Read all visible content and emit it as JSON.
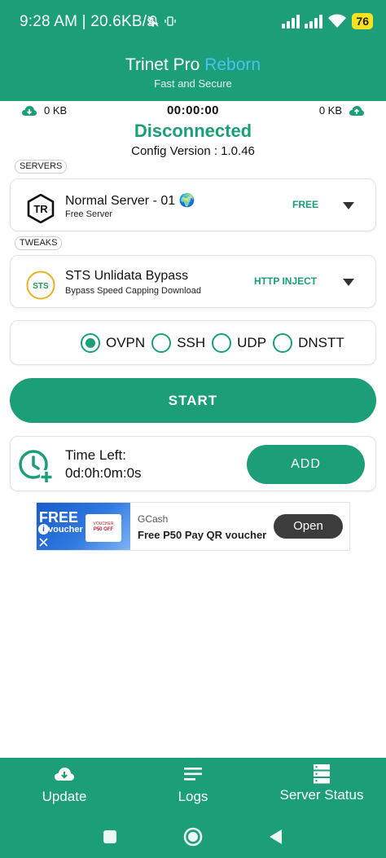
{
  "colors": {
    "accent": "#1c9e78",
    "title_highlight": "#48c3f5",
    "battery": "#f7e21f",
    "ad_button": "#3c3c3c"
  },
  "status_bar": {
    "time_speed": "9:28 AM | 20.6KB/s",
    "battery": "76",
    "icons": [
      "mute-icon",
      "vibrate-icon",
      "signal-icon",
      "signal-icon",
      "wifi-icon",
      "battery-icon"
    ]
  },
  "header": {
    "title_main": "Trinet Pro",
    "title_highlight": "Reborn",
    "subtitle": "Fast and Secure"
  },
  "traffic": {
    "download": "0 KB",
    "timer": "00:00:00",
    "upload": "0 KB"
  },
  "connection": {
    "status": "Disconnected",
    "config_version": "Config Version : 1.0.46"
  },
  "servers": {
    "section_label": "SERVERS",
    "name": "Normal Server - 01 🌍",
    "subtitle": "Free Server",
    "tag": "FREE",
    "logo_text": "TR"
  },
  "tweaks": {
    "section_label": "TWEAKS",
    "name": "STS Unlidata Bypass",
    "subtitle": "Bypass Speed Capping Download",
    "tag": "HTTP INJECT",
    "logo_text": "STS"
  },
  "protocols": {
    "options": [
      "OVPN",
      "SSH",
      "UDP",
      "DNSTT"
    ],
    "selected": "OVPN"
  },
  "start_button": "START",
  "time_card": {
    "label": "Time Left:",
    "value": "0d:0h:0m:0s",
    "add_button": "ADD"
  },
  "ad": {
    "image_free": "FREE",
    "image_voucher": "voucher",
    "image_box_line1": "VOUCHER",
    "image_box_line2": "P50 OFF",
    "brand": "GCash",
    "text": "Free P50 Pay QR voucher",
    "button": "Open"
  },
  "bottom_nav": {
    "items": [
      {
        "label": "Update",
        "icon": "cloud-download-icon"
      },
      {
        "label": "Logs",
        "icon": "logs-icon"
      },
      {
        "label": "Server Status",
        "icon": "server-icon"
      }
    ]
  },
  "system_nav": [
    "recents-button",
    "home-button",
    "back-button"
  ]
}
